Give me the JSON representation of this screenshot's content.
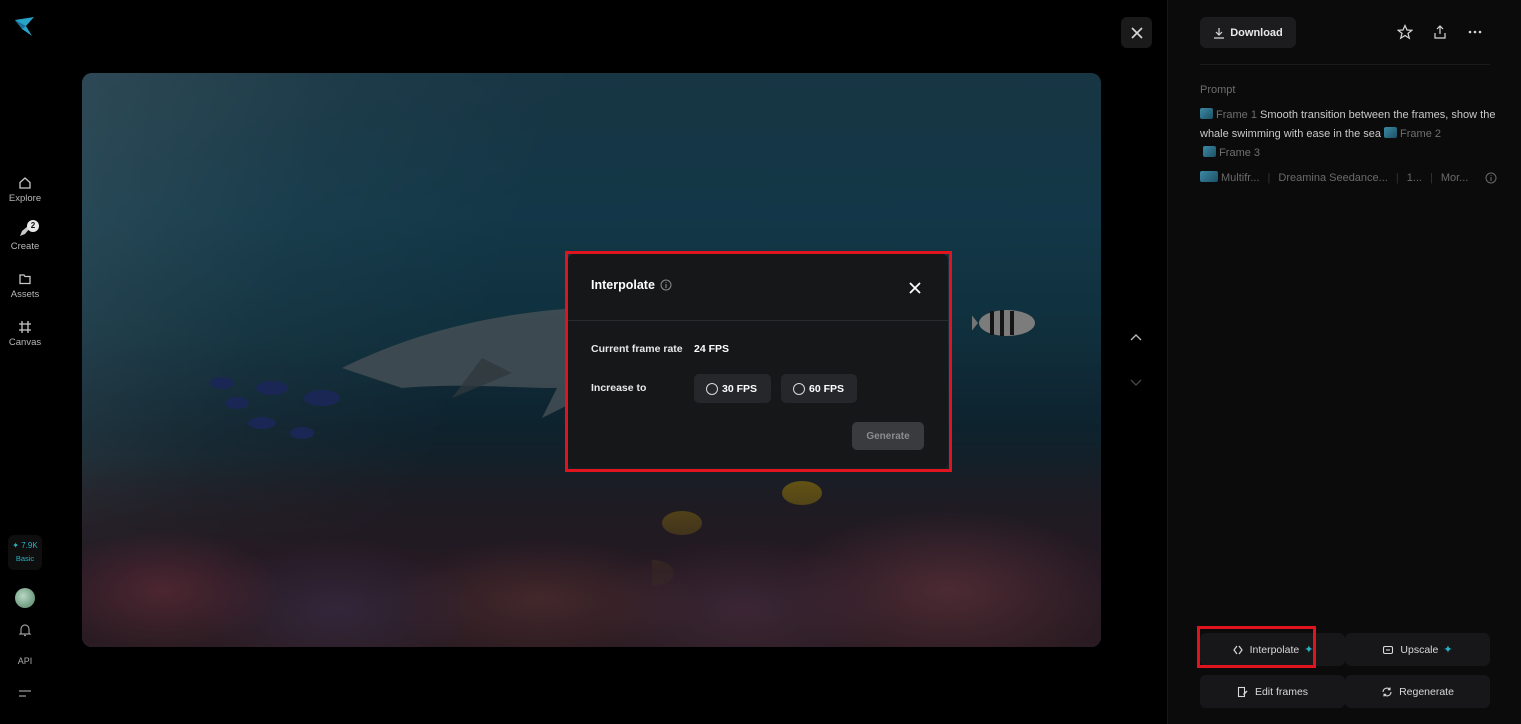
{
  "nav": {
    "items": [
      {
        "label": "Explore",
        "icon": "home-icon"
      },
      {
        "label": "Create",
        "icon": "create-icon",
        "badge": "2"
      },
      {
        "label": "Assets",
        "icon": "folder-icon"
      },
      {
        "label": "Canvas",
        "icon": "canvas-icon"
      }
    ],
    "credits_value": "✦ 7.9K",
    "credits_plan": "Basic",
    "api_label": "API"
  },
  "dialog": {
    "title": "Interpolate",
    "current_label": "Current frame rate",
    "current_value": "24 FPS",
    "increase_label": "Increase to",
    "option_30": "30 FPS",
    "option_60": "60 FPS",
    "generate_label": "Generate"
  },
  "panel": {
    "download_label": "Download",
    "prompt_label": "Prompt",
    "frame1": "Frame 1",
    "prompt_text": "Smooth transition between the frames, show the whale swimming with ease in the sea",
    "frame2": "Frame 2",
    "frame3": "Frame 3",
    "meta_mode": "Multifr...",
    "meta_model": "Dreamina Seedance...",
    "meta_num": "1...",
    "meta_more": "Mor...",
    "interpolate_label": "Interpolate",
    "upscale_label": "Upscale",
    "edit_frames_label": "Edit frames",
    "regenerate_label": "Regenerate"
  },
  "colors": {
    "accent": "#27b3c5",
    "highlight": "#e0141e"
  }
}
